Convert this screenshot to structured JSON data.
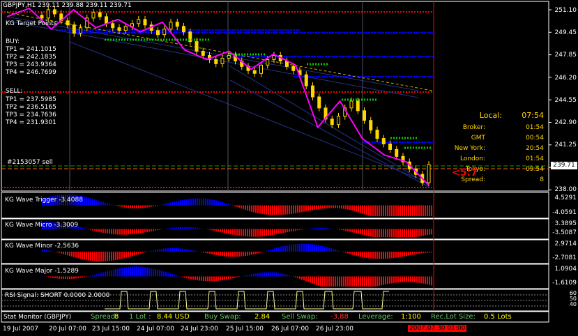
{
  "header": {
    "symbol_line": "GBPJPY,H1  239.11 239.88 239.11 239.71",
    "indicator_line": "KG Target Points"
  },
  "targets": {
    "buy_title": "BUY:",
    "buy": [
      "TP1 = 241.1015",
      "TP2 = 242.1835",
      "TP3 = 243.9364",
      "TP4 = 246.7699"
    ],
    "sell_title": "SELL:",
    "sell": [
      "TP1 = 237.5985",
      "TP2 = 236.5165",
      "TP3 = 234.7636",
      "TP4 = 231.9301"
    ],
    "order_label": "#2153057 sell"
  },
  "price_axis": {
    "ticks": [
      "251.10",
      "249.45",
      "247.85",
      "246.20",
      "244.55",
      "242.90",
      "241.25",
      "239.60",
      "238.00"
    ],
    "current_price": "239.71"
  },
  "clock": {
    "local_label": "Local:",
    "local_value": "07:54",
    "rows": [
      {
        "label": "Broker:",
        "value": "01:54"
      },
      {
        "label": "GMT",
        "value": "00:54"
      },
      {
        "label": "New York:",
        "value": "20:54"
      },
      {
        "label": "London:",
        "value": "01:54"
      },
      {
        "label": "Tokyo:",
        "value": "09:54"
      },
      {
        "label": "Spread:",
        "value": "8"
      }
    ],
    "countdown": "<5:7"
  },
  "subpanels": [
    {
      "title": "KG Wave Trigger",
      "value": "-3.4088",
      "ticks": [
        "4.5291",
        "-4.0591"
      ]
    },
    {
      "title": "KG Wave Micro",
      "value": "-3.3009",
      "ticks": [
        "3.3895",
        "-3.5087"
      ]
    },
    {
      "title": "KG Wave Minor",
      "value": "-2.5636",
      "ticks": [
        "2.9714",
        "-2.7081"
      ]
    },
    {
      "title": "KG Wave Major",
      "value": "-1.5289",
      "ticks": [
        "1.0904",
        "-1.6109"
      ]
    },
    {
      "title": "RSI Signal: SHORT",
      "value": "0.0000 2.0000",
      "ticks": [
        "60",
        "50",
        "40"
      ]
    }
  ],
  "status_bar": {
    "title": "Stat Monitor (GBPJPY)",
    "spread_label": "Spread:",
    "spread_value": "8",
    "lot_label": "1 Lot :",
    "lot_value": "8.44 USD",
    "buy_swap_label": "Buy Swap:",
    "buy_swap_value": "2.84",
    "sell_swap_label": "Sell Swap:",
    "sell_swap_value": "-3.88",
    "leverage_label": "Leverage:",
    "leverage_value": "1:100",
    "rec_lot_label": "Rec.Lot Size:",
    "rec_lot_value": "0.5 Lots"
  },
  "time_axis": {
    "labels": [
      "19 Jul 2007",
      "20 Jul 07:00",
      "23 Jul 15:00",
      "24 Jul 07:00",
      "24 Jul 23:00",
      "25 Jul 15:00",
      "26 Jul 07:00",
      "26 Jul 23:00"
    ],
    "cursor_label": "2007.07.30 01:00"
  },
  "colors": {
    "bull": "#ffd700",
    "bear": "#ffd700",
    "buy_line": "#0000ff",
    "sell_line": "#ff0000",
    "zigzag": "#ff00ff",
    "target_buy": "#00cc00",
    "hist_up": "#0000ff",
    "hist_down": "#ff0000"
  },
  "chart_data": {
    "type": "candlestick",
    "symbol": "GBPJPY",
    "timeframe": "H1",
    "ylim": [
      238.0,
      251.1
    ],
    "ohlc_last": {
      "open": 239.11,
      "high": 239.88,
      "low": 239.11,
      "close": 239.71
    },
    "buy_targets": [
      241.1015,
      242.1835,
      243.9364,
      246.7699
    ],
    "sell_targets": [
      237.5985,
      236.5165,
      234.7636,
      231.9301
    ],
    "zigzag_path": [
      250.4,
      251.0,
      249.5,
      250.9,
      249.6,
      250.2,
      249.3,
      250.0,
      248.0,
      247.3,
      247.9,
      246.6,
      247.7,
      246.9,
      242.4,
      244.3,
      241.6,
      240.4,
      239.9,
      238.2
    ],
    "zigzag_x_fraction_note": "",
    "closes": [
      250.3,
      250.9,
      250.6,
      250.1,
      249.8,
      249.2,
      249.6,
      250.3,
      250.7,
      250.4,
      249.9,
      249.6,
      249.4,
      249.7,
      249.9,
      250.2,
      249.8,
      249.4,
      249.1,
      249.5,
      250.0,
      249.7,
      249.3,
      248.6,
      247.9,
      247.6,
      247.3,
      247.0,
      247.4,
      247.6,
      247.2,
      246.8,
      246.5,
      246.3,
      246.9,
      247.3,
      247.6,
      247.2,
      246.8,
      246.5,
      246.2,
      245.4,
      244.6,
      243.8,
      243.0,
      242.6,
      243.2,
      243.8,
      244.3,
      243.6,
      242.9,
      242.2,
      241.6,
      241.2,
      240.8,
      240.3,
      239.9,
      239.4,
      239.0,
      238.4,
      239.71
    ]
  }
}
